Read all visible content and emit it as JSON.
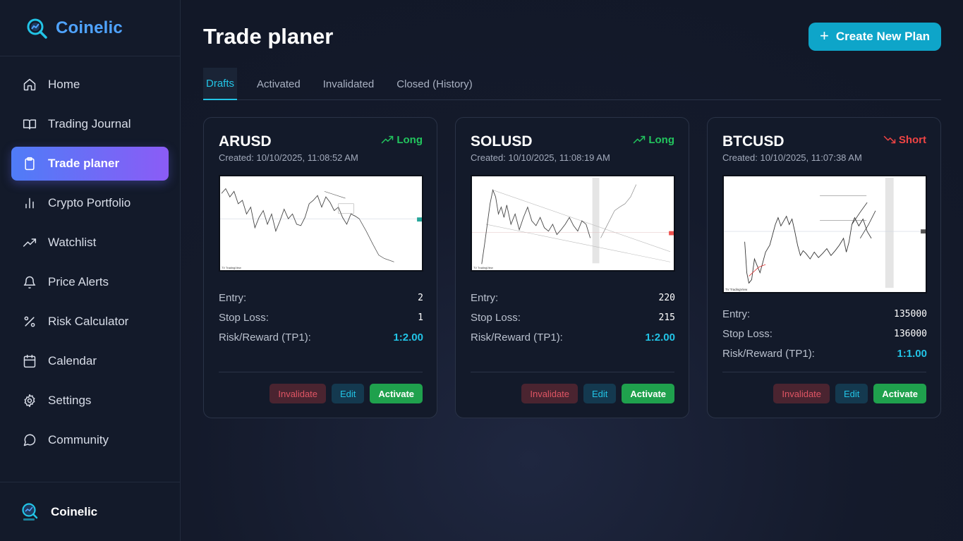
{
  "app": {
    "name": "Coinelic"
  },
  "sidebar": {
    "items": [
      {
        "label": "Home",
        "icon": "home-icon"
      },
      {
        "label": "Trading Journal",
        "icon": "book-icon"
      },
      {
        "label": "Trade planer",
        "icon": "clipboard-icon",
        "active": true
      },
      {
        "label": "Crypto Portfolio",
        "icon": "bar-chart-icon"
      },
      {
        "label": "Watchlist",
        "icon": "trending-up-icon"
      },
      {
        "label": "Price Alerts",
        "icon": "bell-icon"
      },
      {
        "label": "Risk Calculator",
        "icon": "percent-icon"
      },
      {
        "label": "Calendar",
        "icon": "calendar-icon"
      },
      {
        "label": "Settings",
        "icon": "gear-icon"
      },
      {
        "label": "Community",
        "icon": "chat-bubble-icon"
      }
    ],
    "footer_name": "Coinelic"
  },
  "header": {
    "title": "Trade planer",
    "create_button": "Create New Plan"
  },
  "tabs": [
    {
      "label": "Drafts",
      "active": true
    },
    {
      "label": "Activated"
    },
    {
      "label": "Invalidated"
    },
    {
      "label": "Closed (History)"
    }
  ],
  "colors": {
    "accent": "#22c4e6",
    "long": "#22c55e",
    "short": "#ef4444",
    "nav_active_from": "#4f7cf7",
    "nav_active_to": "#8b5cf6"
  },
  "plans": [
    {
      "pair": "ARUSD",
      "created": "Created: 10/10/2025, 11:08:52 AM",
      "direction": "Long",
      "entry_label": "Entry:",
      "entry": "2",
      "stop_label": "Stop Loss:",
      "stop": "1",
      "rr_label": "Risk/Reward (TP1):",
      "rr": "1:2.00",
      "actions": {
        "invalidate": "Invalidate",
        "edit": "Edit",
        "activate": "Activate"
      }
    },
    {
      "pair": "SOLUSD",
      "created": "Created: 10/10/2025, 11:08:19 AM",
      "direction": "Long",
      "entry_label": "Entry:",
      "entry": "220",
      "stop_label": "Stop Loss:",
      "stop": "215",
      "rr_label": "Risk/Reward (TP1):",
      "rr": "1:2.00",
      "actions": {
        "invalidate": "Invalidate",
        "edit": "Edit",
        "activate": "Activate"
      }
    },
    {
      "pair": "BTCUSD",
      "created": "Created: 10/10/2025, 11:07:38 AM",
      "direction": "Short",
      "entry_label": "Entry:",
      "entry": "135000",
      "stop_label": "Stop Loss:",
      "stop": "136000",
      "rr_label": "Risk/Reward (TP1):",
      "rr": "1:1.00",
      "actions": {
        "invalidate": "Invalidate",
        "edit": "Edit",
        "activate": "Activate"
      }
    }
  ]
}
